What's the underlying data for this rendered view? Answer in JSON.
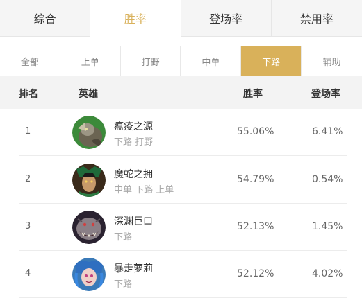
{
  "colors": {
    "accent": "#d9b15a"
  },
  "top_tabs": [
    {
      "label": "综合"
    },
    {
      "label": "胜率"
    },
    {
      "label": "登场率"
    },
    {
      "label": "禁用率"
    }
  ],
  "sub_tabs": [
    {
      "label": "全部"
    },
    {
      "label": "上单"
    },
    {
      "label": "打野"
    },
    {
      "label": "中单"
    },
    {
      "label": "下路"
    },
    {
      "label": "辅助"
    }
  ],
  "table": {
    "headers": {
      "rank": "排名",
      "hero": "英雄",
      "win": "胜率",
      "pick": "登场率"
    },
    "rows": [
      {
        "rank": "1",
        "name": "瘟疫之源",
        "roles": "下路 打野",
        "win": "55.06%",
        "pick": "6.41%",
        "avatar_icon": "twitch-portrait"
      },
      {
        "rank": "2",
        "name": "魔蛇之拥",
        "roles": "中单 下路 上单",
        "win": "54.79%",
        "pick": "0.54%",
        "avatar_icon": "cassiopeia-portrait"
      },
      {
        "rank": "3",
        "name": "深渊巨口",
        "roles": "下路",
        "win": "52.13%",
        "pick": "1.45%",
        "avatar_icon": "kogmaw-portrait"
      },
      {
        "rank": "4",
        "name": "暴走萝莉",
        "roles": "下路",
        "win": "52.12%",
        "pick": "4.02%",
        "avatar_icon": "jinx-portrait"
      }
    ]
  }
}
